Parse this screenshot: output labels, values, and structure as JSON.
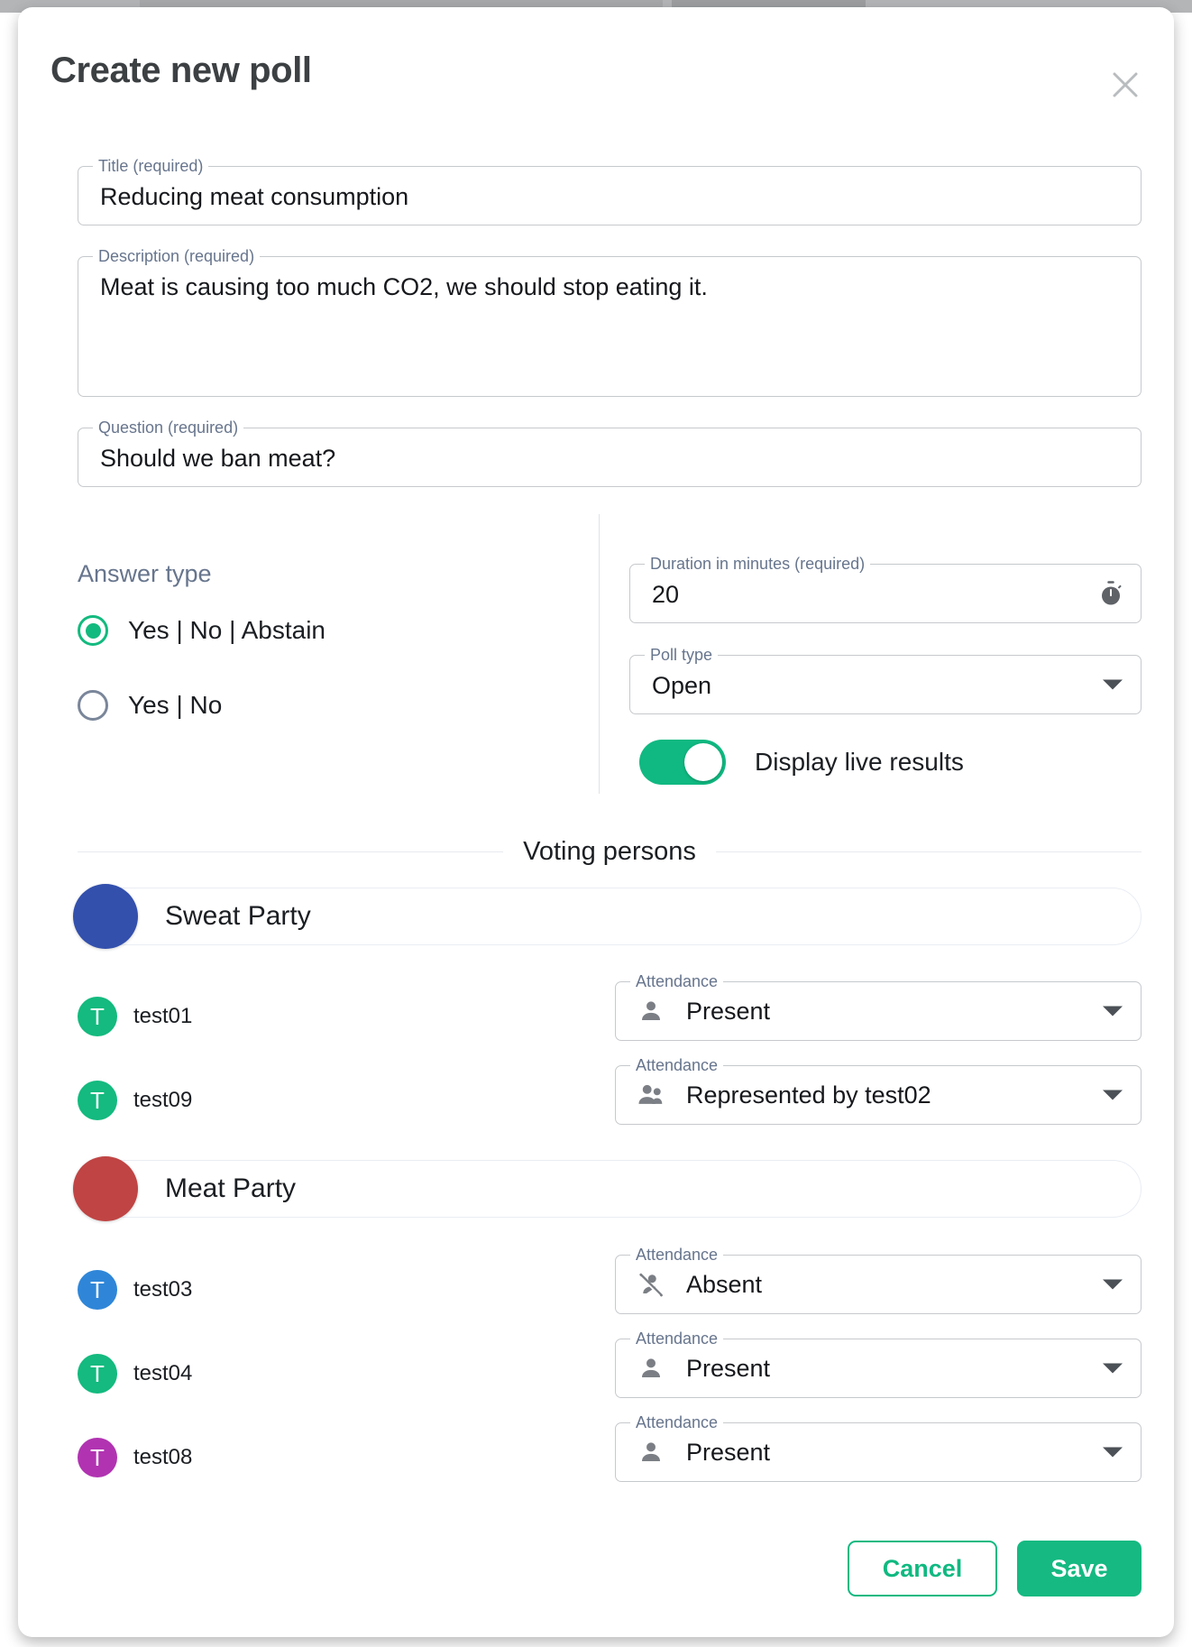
{
  "dialog": {
    "title": "Create new poll",
    "close_icon": "close-icon"
  },
  "fields": {
    "title": {
      "legend": "Title (required)",
      "value": "Reducing meat consumption"
    },
    "description": {
      "legend": "Description (required)",
      "value": "Meat is causing too much CO2, we should stop eating it."
    },
    "question": {
      "legend": "Question (required)",
      "value": "Should we ban meat?"
    },
    "duration": {
      "legend": "Duration in minutes (required)",
      "value": "20",
      "icon": "timer-icon"
    },
    "poll_type": {
      "legend": "Poll type",
      "value": "Open",
      "icon": "chevron-down-icon"
    }
  },
  "answer_type": {
    "title": "Answer type",
    "options": [
      {
        "label": "Yes | No | Abstain",
        "selected": true
      },
      {
        "label": "Yes | No",
        "selected": false
      }
    ]
  },
  "live_results": {
    "label": "Display live results",
    "enabled": true
  },
  "voting": {
    "section_title": "Voting persons",
    "parties": [
      {
        "name": "Sweat Party",
        "color": "#3350ad",
        "members": [
          {
            "name": "test01",
            "initial": "T",
            "avatar_color": "#14ba7f",
            "attendance_legend": "Attendance",
            "attendance": "Present",
            "attendance_icon": "person-icon"
          },
          {
            "name": "test09",
            "initial": "T",
            "avatar_color": "#14ba7f",
            "attendance_legend": "Attendance",
            "attendance": "Represented by test02",
            "attendance_icon": "people-icon"
          }
        ]
      },
      {
        "name": "Meat Party",
        "color": "#c04444",
        "members": [
          {
            "name": "test03",
            "initial": "T",
            "avatar_color": "#2f86d8",
            "attendance_legend": "Attendance",
            "attendance": "Absent",
            "attendance_icon": "person-off-icon"
          },
          {
            "name": "test04",
            "initial": "T",
            "avatar_color": "#14ba7f",
            "attendance_legend": "Attendance",
            "attendance": "Present",
            "attendance_icon": "person-icon"
          },
          {
            "name": "test08",
            "initial": "T",
            "avatar_color": "#b133b1",
            "attendance_legend": "Attendance",
            "attendance": "Present",
            "attendance_icon": "person-icon"
          }
        ]
      }
    ]
  },
  "footer": {
    "cancel_label": "Cancel",
    "save_label": "Save"
  },
  "colors": {
    "accent": "#10b981",
    "label": "#67758d",
    "text": "#1b1e22"
  }
}
